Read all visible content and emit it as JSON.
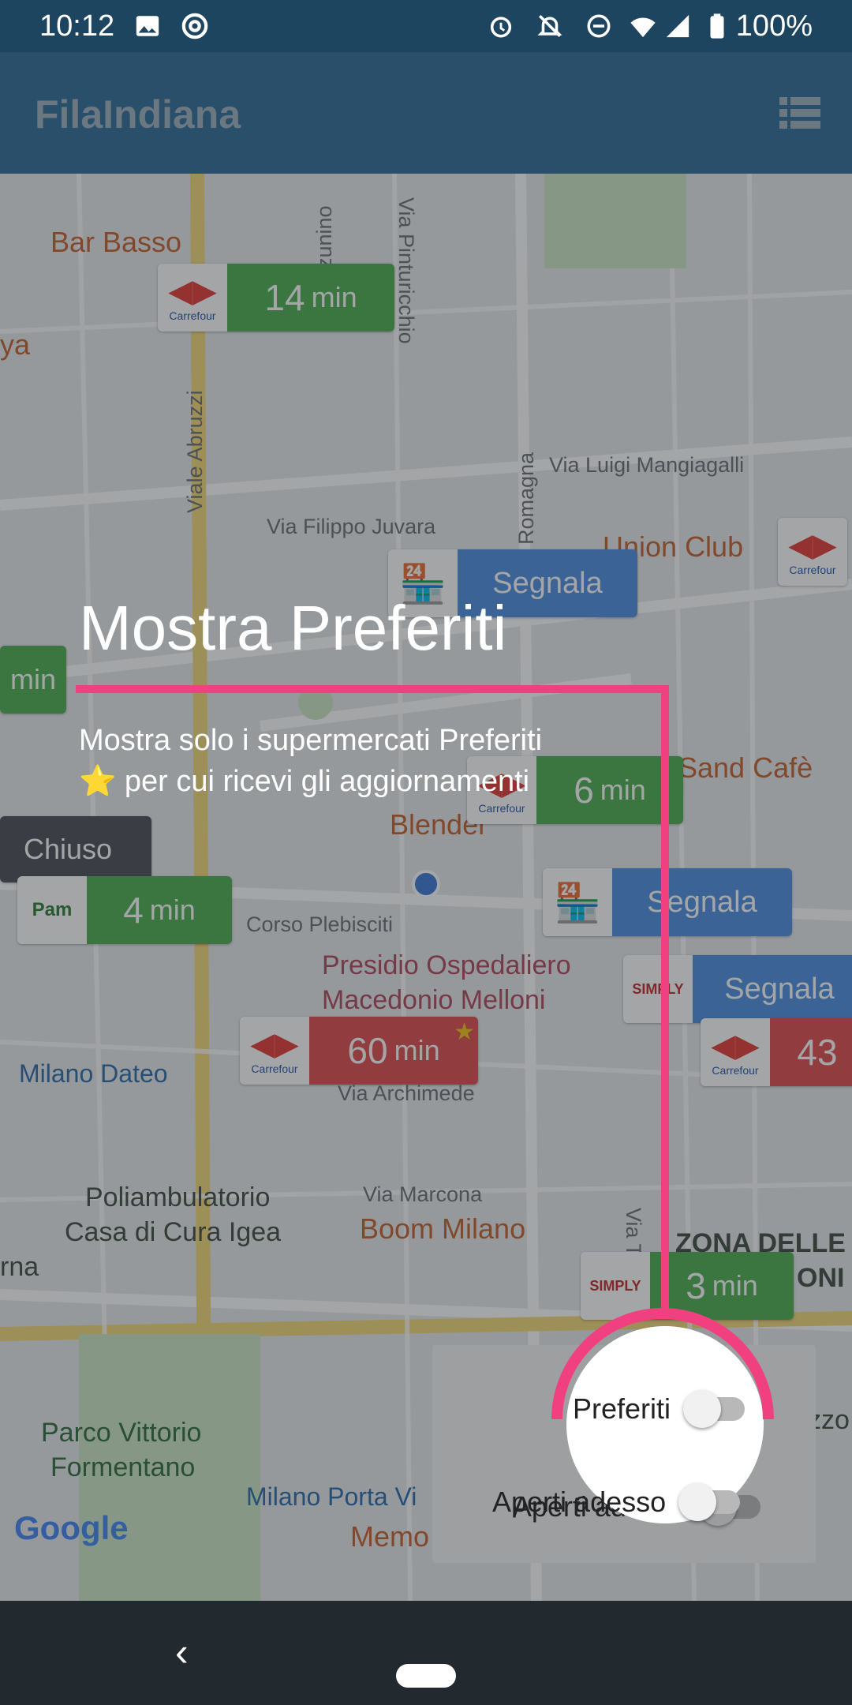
{
  "status_bar": {
    "time": "10:12",
    "battery": "100%",
    "icons": [
      "image-icon",
      "at-icon",
      "alarm-icon",
      "bell-off-icon",
      "dnd-icon",
      "wifi-icon",
      "signal-icon",
      "battery-icon"
    ]
  },
  "app_bar": {
    "title": "FilaIndiana",
    "list_icon": "list-icon"
  },
  "map": {
    "labels": {
      "bar_basso": "Bar Basso",
      "ya": "ya",
      "via_pinturicchio": "Via Pinturicchio",
      "zunino": "zunino",
      "viale_abruzzi": "Viale Abruzzi",
      "via_luigi": "Via Luigi Mangiagalli",
      "via_filippo": "Via Filippo Juvara",
      "romagna": "Romagna",
      "union_club": "Union Club",
      "sand_cafe": "Sand Cafè",
      "blender": "Blender",
      "corso_plebisciti": "Corso Plebisciti",
      "presidio": "Presidio Ospedaliero",
      "macedonio": "Macedonio Melloni",
      "milano_dateo": "Milano Dateo",
      "via_archimede": "Via Archimede",
      "poliambulatorio": "Poliambulatorio",
      "casa_cura": "Casa di Cura Igea",
      "via_marcona": "Via Marcona",
      "boom_milano": "Boom Milano",
      "zona_delle": "ZONA DELLE",
      "oni": "ONI",
      "rna": "rna",
      "parco": "Parco Vittorio",
      "formentano": "Formentano",
      "milano_porta": "Milano Porta Vi",
      "memo": "Memo",
      "google": "Google",
      "zzo": "zzo",
      "via_t": "Via T"
    },
    "markers": {
      "m1": {
        "brand": "Carrefour",
        "value": "14",
        "unit": "min"
      },
      "m2": {
        "action": "Segnala"
      },
      "m3": {
        "brand": "Carrefour"
      },
      "m4": {
        "value": "min"
      },
      "m5": {
        "brand": "Carrefour",
        "value": "6",
        "unit": "min"
      },
      "m6": {
        "status": "Chiuso"
      },
      "m7": {
        "brand": "Pam",
        "value": "4",
        "unit": "min"
      },
      "m8": {
        "action": "Segnala"
      },
      "m9": {
        "brand": "SIMPLY",
        "action": "Segnala"
      },
      "m10": {
        "brand": "Carrefour",
        "value": "60",
        "unit": "min"
      },
      "m11": {
        "brand": "Carrefour",
        "value": "43"
      },
      "m12": {
        "brand": "SIMPLY",
        "value": "3",
        "unit": "min"
      }
    }
  },
  "filters": {
    "preferiti": {
      "label": "Preferiti",
      "on": false
    },
    "aperti": {
      "label": "Aperti adesso",
      "on": false
    }
  },
  "tooltip": {
    "title": "Mostra Preferiti",
    "text_line1": "Mostra solo i supermercati Preferiti",
    "text_line2": "⭐ per cui ricevi gli aggiornamenti",
    "accent": "#f04080"
  },
  "nav": {
    "back": "‹"
  }
}
